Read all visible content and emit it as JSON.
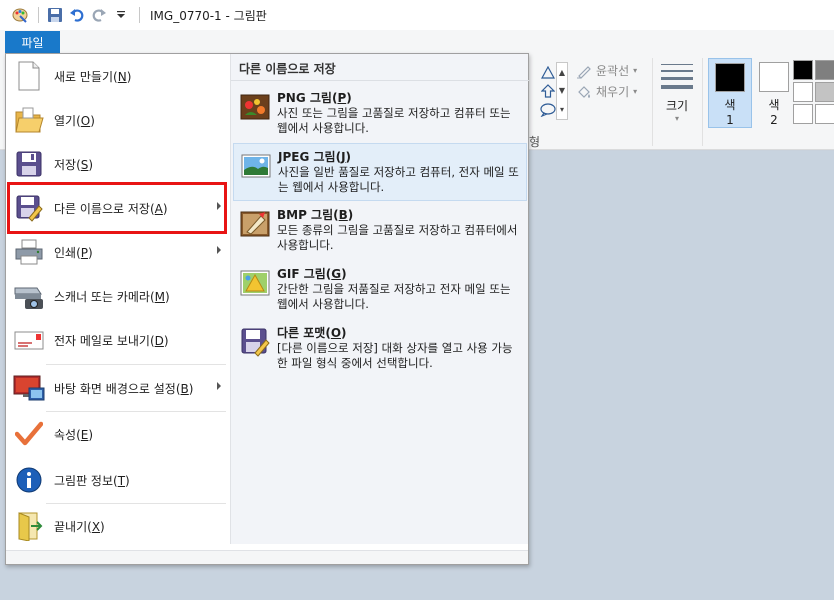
{
  "titlebar": {
    "title": "IMG_0770-1 - 그림판"
  },
  "ribbon": {
    "outline_label": "윤곽선",
    "fill_label": "채우기",
    "size_label": "크기",
    "color1_label_line1": "색",
    "color1_label_line2": "1",
    "color2_label_line1": "색",
    "color2_label_line2": "2",
    "shapes_group_label": "형",
    "color1_value": "#000000",
    "color2_value": "#ffffff",
    "palette": [
      "#000000",
      "#7f7f7f",
      "#ffffff",
      "#c3c3c3",
      "#ffffff",
      "#ffffff"
    ]
  },
  "file_menu": {
    "tab_label": "파일",
    "items": [
      {
        "label": "새로 만들기",
        "key": "N",
        "icon": "new-document-icon"
      },
      {
        "label": "열기",
        "key": "O",
        "icon": "open-folder-icon"
      },
      {
        "label": "저장",
        "key": "S",
        "icon": "save-disk-icon"
      },
      {
        "label": "다른 이름으로 저장",
        "key": "A",
        "icon": "save-as-icon",
        "has_submenu": true
      },
      {
        "label": "인쇄",
        "key": "P",
        "icon": "printer-icon",
        "has_submenu": true
      },
      {
        "label": "스캐너 또는 카메라",
        "key": "M",
        "icon": "scanner-icon"
      },
      {
        "label": "전자 메일로 보내기",
        "key": "D",
        "icon": "email-icon"
      },
      {
        "label": "바탕 화면 배경으로 설정",
        "key": "B",
        "icon": "desktop-background-icon",
        "has_submenu": true
      },
      {
        "label": "속성",
        "key": "E",
        "icon": "checkmark-icon"
      },
      {
        "label": "그림판 정보",
        "key": "T",
        "icon": "info-icon"
      },
      {
        "label": "끝내기",
        "key": "X",
        "icon": "exit-icon"
      }
    ]
  },
  "save_as_submenu": {
    "title": "다른 이름으로 저장",
    "items": [
      {
        "name": "PNG 그림",
        "key": "P",
        "desc": "사진 또는 그림을 고품질로 저장하고 컴퓨터 또는 웹에서 사용합니다.",
        "icon": "png-picture-icon"
      },
      {
        "name": "JPEG 그림",
        "key": "J",
        "desc": "사진을 일반 품질로 저장하고 컴퓨터, 전자 메일 또는 웹에서 사용합니다.",
        "icon": "jpeg-picture-icon",
        "active": true
      },
      {
        "name": "BMP 그림",
        "key": "B",
        "desc": "모든 종류의 그림을 고품질로 저장하고 컴퓨터에서 사용합니다.",
        "icon": "bmp-picture-icon"
      },
      {
        "name": "GIF 그림",
        "key": "G",
        "desc": "간단한 그림을 저품질로 저장하고 전자 메일 또는 웹에서 사용합니다.",
        "icon": "gif-picture-icon"
      },
      {
        "name": "다른 포맷",
        "key": "O",
        "desc": "[다른 이름으로 저장] 대화 상자를 열고 사용 가능한 파일 형식 중에서 선택합니다.",
        "icon": "other-format-icon"
      }
    ]
  }
}
